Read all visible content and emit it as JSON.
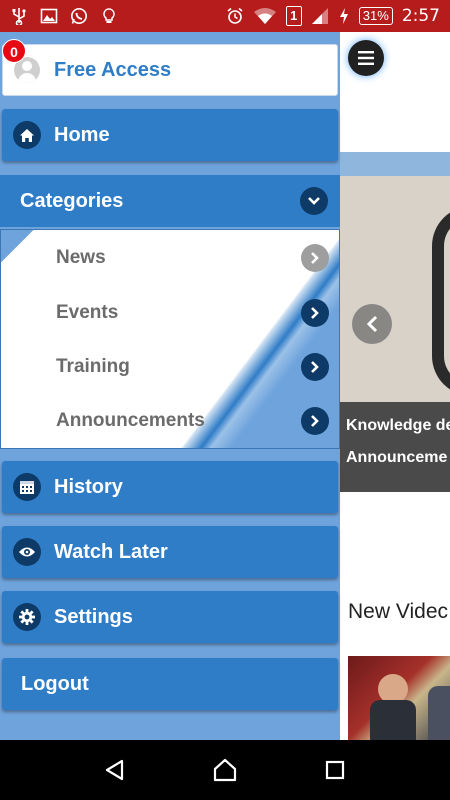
{
  "status_bar": {
    "battery": "31%",
    "time": "2:57",
    "sim_slot": "1"
  },
  "drawer": {
    "profile": {
      "label": "Free Access",
      "badge": "0"
    },
    "home": "Home",
    "categories": {
      "label": "Categories",
      "items": [
        {
          "label": "News"
        },
        {
          "label": "Events"
        },
        {
          "label": "Training"
        },
        {
          "label": "Announcements"
        }
      ]
    },
    "history": "History",
    "watch_later": "Watch Later",
    "settings": "Settings",
    "logout": "Logout"
  },
  "content": {
    "slider_caption_line1": "Knowledge de",
    "slider_caption_line2": "Announceme",
    "new_videos_heading": "New Videc"
  },
  "colors": {
    "accent": "#2f7cc7",
    "drawer_bg": "#6fa3dc",
    "status_bar": "#b71c1c",
    "icon_circle": "#0d3a66",
    "badge": "#e50914"
  },
  "icons": {
    "status_left": [
      "usb-icon",
      "image-icon",
      "whatsapp-icon",
      "lightbulb-icon"
    ],
    "status_right": [
      "alarm-icon",
      "wifi-icon",
      "sim-icon",
      "signal-icon",
      "charging-icon"
    ],
    "nav": [
      "back-icon",
      "home-nav-icon",
      "recents-icon"
    ]
  }
}
